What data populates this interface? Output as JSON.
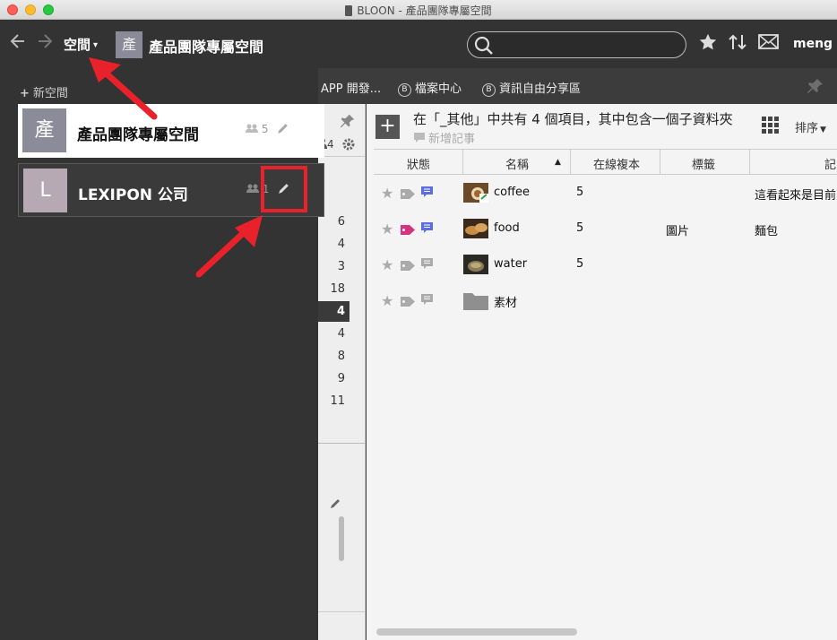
{
  "window": {
    "title": "BLOON - 產品團隊專屬空間"
  },
  "topbar": {
    "space_menu_label": "空間",
    "current_space_avatar": "產",
    "current_space_name": "產品團隊專屬空間",
    "search_placeholder": "",
    "user": "meng"
  },
  "tabs": [
    {
      "label": "APP 開發...",
      "badge": ""
    },
    {
      "label": "檔案中心",
      "badge": "B"
    },
    {
      "label": "資訊自由分享區",
      "badge": "B"
    }
  ],
  "panel": {
    "new_space_label": "新空間",
    "spaces": [
      {
        "avatar": "產",
        "name": "產品團隊專屬空間",
        "members": "5",
        "avatar_color": "#8b8b99"
      },
      {
        "avatar": "L",
        "name": "LEXIPON 公司",
        "members": "1",
        "avatar_color": "#b7a9b3"
      }
    ]
  },
  "midcol": {
    "members_count": "4",
    "numbers": [
      "6",
      "4",
      "3",
      "18",
      "4",
      "4",
      "8",
      "9",
      "11"
    ],
    "selected_index": 4
  },
  "main": {
    "folder_title": "在「_其他」中共有 4 個項目，其中包含一個子資料夾",
    "new_note_label": "新增記事",
    "sort_label": "排序",
    "columns": [
      "狀態",
      "名稱",
      "在線複本",
      "標籤",
      "記"
    ],
    "rows": [
      {
        "name": "coffee",
        "copies": "5",
        "label": "",
        "note": "這看起來是目前",
        "tag_color": "#aaaaaa",
        "memo_color": "#5b6ee1",
        "thumb": "coffee"
      },
      {
        "name": "food",
        "copies": "5",
        "label": "圖片",
        "note": "麵包",
        "tag_color": "#d6337f",
        "memo_color": "#5b6ee1",
        "thumb": "food"
      },
      {
        "name": "water",
        "copies": "5",
        "label": "",
        "note": "",
        "tag_color": "#aaaaaa",
        "memo_color": "#aaaaaa",
        "thumb": "water"
      },
      {
        "name": "素材",
        "copies": "",
        "label": "",
        "note": "",
        "tag_color": "#aaaaaa",
        "memo_color": "#aaaaaa",
        "thumb": "folder"
      }
    ]
  },
  "colors": {
    "accent_highlight": "#e8212a",
    "topbar": "#333333"
  }
}
